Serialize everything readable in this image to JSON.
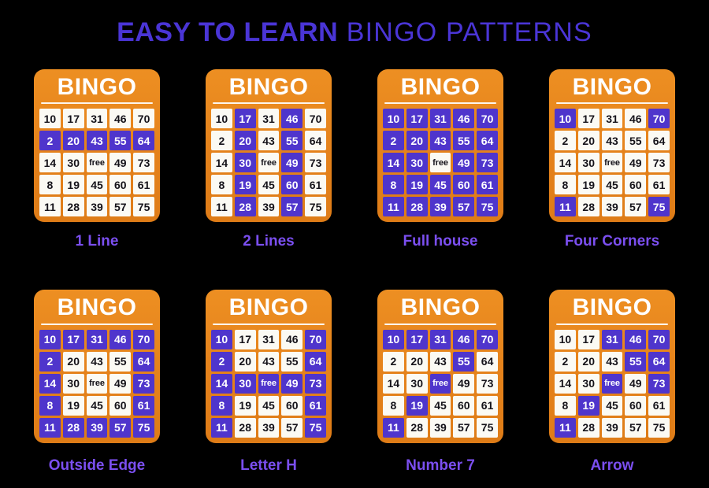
{
  "title": {
    "strong": "EASY TO LEARN",
    "light": " BINGO PATTERNS"
  },
  "colors": {
    "background": "#000000",
    "title": "#4a35d6",
    "caption": "#7b4ff0",
    "card_orange": "#e5821b",
    "cell_white": "#fbfaf4",
    "cell_marked": "#4f35cc",
    "cell_text": "#15131a",
    "cell_marked_text": "#ffffff"
  },
  "card_header_label": "BINGO",
  "free_label": "free",
  "numbers": [
    [
      "10",
      "17",
      "31",
      "46",
      "70"
    ],
    [
      "2",
      "20",
      "43",
      "55",
      "64"
    ],
    [
      "14",
      "30",
      "free",
      "49",
      "73"
    ],
    [
      "8",
      "19",
      "45",
      "60",
      "61"
    ],
    [
      "11",
      "28",
      "39",
      "57",
      "75"
    ]
  ],
  "cards": [
    {
      "caption": "1 Line",
      "header": "BINGO",
      "marked": [
        [
          false,
          false,
          false,
          false,
          false
        ],
        [
          true,
          true,
          true,
          true,
          true
        ],
        [
          false,
          false,
          false,
          false,
          false
        ],
        [
          false,
          false,
          false,
          false,
          false
        ],
        [
          false,
          false,
          false,
          false,
          false
        ]
      ]
    },
    {
      "caption": "2 Lines",
      "header": "BINGO",
      "marked": [
        [
          false,
          true,
          false,
          true,
          false
        ],
        [
          false,
          true,
          false,
          true,
          false
        ],
        [
          false,
          true,
          false,
          true,
          false
        ],
        [
          false,
          true,
          false,
          true,
          false
        ],
        [
          false,
          true,
          false,
          true,
          false
        ]
      ]
    },
    {
      "caption": "Full house",
      "header": "BINGO",
      "marked": [
        [
          true,
          true,
          true,
          true,
          true
        ],
        [
          true,
          true,
          true,
          true,
          true
        ],
        [
          true,
          true,
          false,
          true,
          true
        ],
        [
          true,
          true,
          true,
          true,
          true
        ],
        [
          true,
          true,
          true,
          true,
          true
        ]
      ]
    },
    {
      "caption": "Four Corners",
      "header": "BINGO",
      "marked": [
        [
          true,
          false,
          false,
          false,
          true
        ],
        [
          false,
          false,
          false,
          false,
          false
        ],
        [
          false,
          false,
          false,
          false,
          false
        ],
        [
          false,
          false,
          false,
          false,
          false
        ],
        [
          true,
          false,
          false,
          false,
          true
        ]
      ]
    },
    {
      "caption": "Outside Edge",
      "header": "BINGO",
      "marked": [
        [
          true,
          true,
          true,
          true,
          true
        ],
        [
          true,
          false,
          false,
          false,
          true
        ],
        [
          true,
          false,
          false,
          false,
          true
        ],
        [
          true,
          false,
          false,
          false,
          true
        ],
        [
          true,
          true,
          true,
          true,
          true
        ]
      ]
    },
    {
      "caption": "Letter H",
      "header": "BINGO",
      "marked": [
        [
          true,
          false,
          false,
          false,
          true
        ],
        [
          true,
          false,
          false,
          false,
          true
        ],
        [
          true,
          true,
          true,
          true,
          true
        ],
        [
          true,
          false,
          false,
          false,
          true
        ],
        [
          true,
          false,
          false,
          false,
          true
        ]
      ]
    },
    {
      "caption": "Number 7",
      "header": "BINGO",
      "marked": [
        [
          true,
          true,
          true,
          true,
          true
        ],
        [
          false,
          false,
          false,
          true,
          false
        ],
        [
          false,
          false,
          true,
          false,
          false
        ],
        [
          false,
          true,
          false,
          false,
          false
        ],
        [
          true,
          false,
          false,
          false,
          false
        ]
      ]
    },
    {
      "caption": "Arrow",
      "header": "BINGO",
      "marked": [
        [
          false,
          false,
          true,
          true,
          true
        ],
        [
          false,
          false,
          false,
          true,
          true
        ],
        [
          false,
          false,
          true,
          false,
          true
        ],
        [
          false,
          true,
          false,
          false,
          false
        ],
        [
          true,
          false,
          false,
          false,
          false
        ]
      ]
    }
  ]
}
